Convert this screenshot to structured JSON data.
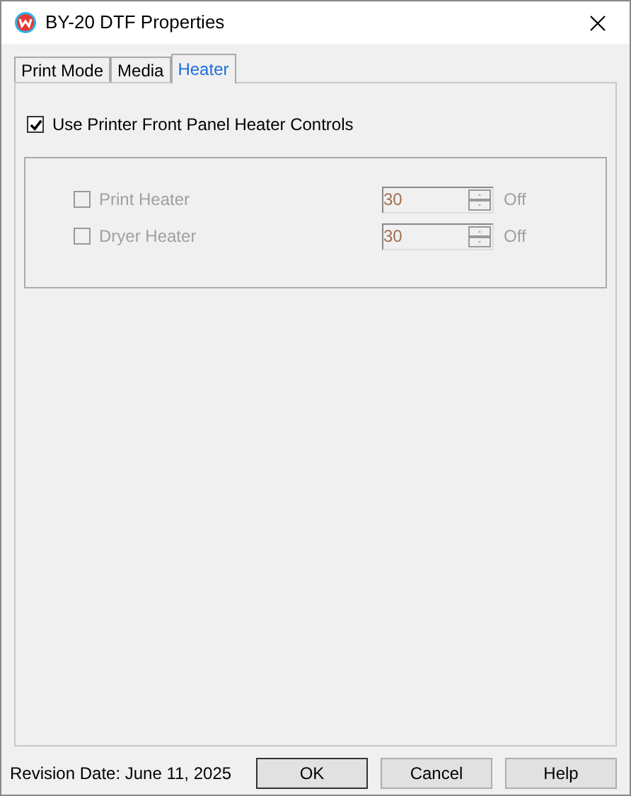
{
  "window": {
    "title": "BY-20 DTF  Properties"
  },
  "tabs": [
    {
      "label": "Print Mode",
      "selected": false
    },
    {
      "label": "Media",
      "selected": false
    },
    {
      "label": "Heater",
      "selected": true
    }
  ],
  "front_panel": {
    "label": "Use Printer Front Panel Heater Controls",
    "checked": true
  },
  "heaters": [
    {
      "label": "Print Heater",
      "checked": false,
      "disabled": true,
      "value": "30",
      "status": "Off"
    },
    {
      "label": "Dryer Heater",
      "checked": false,
      "disabled": true,
      "value": "30",
      "status": "Off"
    }
  ],
  "revision": "Revision Date: June 11, 2025",
  "buttons": [
    "OK",
    "Cancel",
    "Help"
  ]
}
